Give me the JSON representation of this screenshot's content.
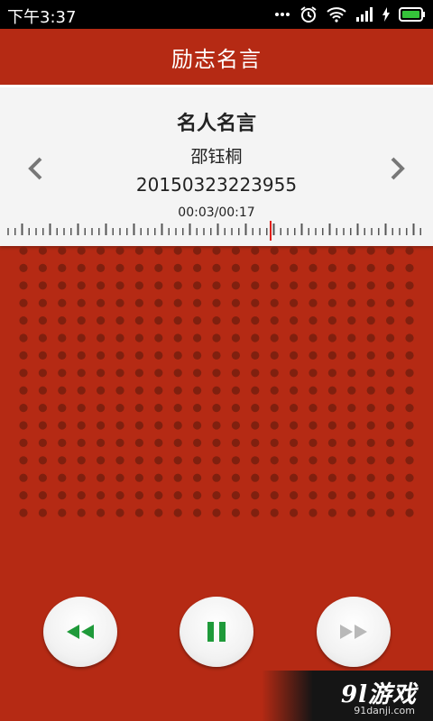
{
  "status_bar": {
    "time": "下午3:37",
    "icons": [
      "more-dots-icon",
      "alarm-icon",
      "wifi-icon",
      "signal-icon",
      "charging-icon",
      "battery-icon"
    ]
  },
  "title_bar": {
    "title": "励志名言"
  },
  "card": {
    "heading": "名人名言",
    "author": "邵钰桐",
    "record_number": "20150323223955",
    "time_display": "00:03/00:17",
    "playback_fraction": 0.18
  },
  "controls": {
    "rewind_icon": "rewind-icon",
    "pause_icon": "pause-icon",
    "forward_icon": "fast-forward-icon"
  },
  "watermark": {
    "logo": "9l游戏",
    "url": "91danji.com"
  },
  "colors": {
    "background": "#b52a14",
    "dot": "#80200f",
    "accent_green": "#1f9a3a",
    "ruler_marker": "#e0201a",
    "forward_disabled": "#b8b8b8"
  }
}
